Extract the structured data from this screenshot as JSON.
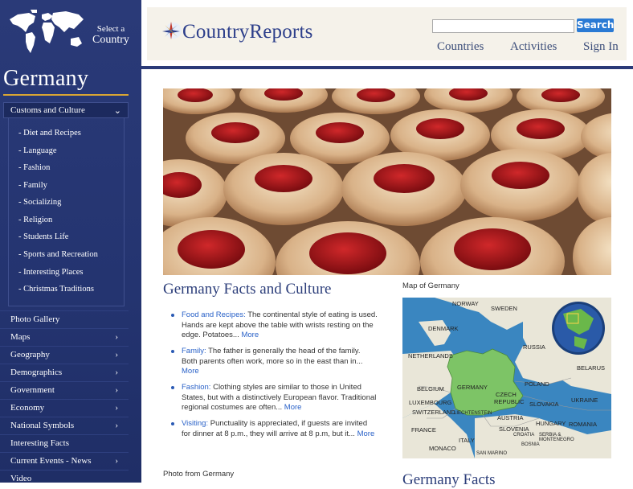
{
  "sidebar": {
    "select_line1": "Select a",
    "select_line2": "Country",
    "country": "Germany",
    "customs": "Customs and Culture",
    "submenu": [
      "- Diet and Recipes",
      "- Language",
      "- Fashion",
      "- Family",
      "- Socializing",
      "- Religion",
      "- Students Life",
      "- Sports and Recreation",
      "- Interesting Places",
      "- Christmas Traditions"
    ],
    "menu": [
      {
        "label": "Photo Gallery",
        "chevron": ""
      },
      {
        "label": "Maps",
        "chevron": "›"
      },
      {
        "label": "Geography",
        "chevron": "›"
      },
      {
        "label": "Demographics",
        "chevron": "›"
      },
      {
        "label": "Government",
        "chevron": "›"
      },
      {
        "label": "Economy",
        "chevron": "›"
      },
      {
        "label": "National Symbols",
        "chevron": "›"
      },
      {
        "label": "Interesting Facts",
        "chevron": ""
      },
      {
        "label": "Current Events - News",
        "chevron": "›"
      },
      {
        "label": "Video",
        "chevron": ""
      }
    ]
  },
  "header": {
    "logo": "CountryReports",
    "search_button": "Search",
    "search_value": "",
    "nav": [
      "Countries",
      "Activities",
      "Sign In"
    ]
  },
  "main": {
    "facts_title": "Germany Facts and Culture",
    "facts": [
      {
        "topic": "Food and Recipes:",
        "text": " The continental style of eating is used. Hands are kept above the table with wrists resting on the edge. Potatoes... ",
        "more": "More"
      },
      {
        "topic": "Family:",
        "text": " The father is generally the head of the family. Both parents often work, more so in the east than in... ",
        "more": "More"
      },
      {
        "topic": "Fashion:",
        "text": " Clothing styles are similar to those in United States, but with a distinctively European flavor. Traditional regional costumes are often... ",
        "more": "More"
      },
      {
        "topic": "Visiting:",
        "text": " Punctuality is appreciated, if guests are invited for dinner at 8 p.m., they will arrive at 8 p.m, but it... ",
        "more": "More"
      }
    ],
    "map_label": "Map of Germany",
    "map_countries": [
      "NORWAY",
      "SWEDEN",
      "DENMARK",
      "RUSSIA",
      "NETHERLANDS",
      "BELARUS",
      "BELGIUM",
      "GERMANY",
      "POLAND",
      "LUXEMBOURG",
      "CZECH",
      "REPUBLIC",
      "UKRAINE",
      "SWITZERLAND",
      "LIECHTENSTEIN",
      "SLOVAKIA",
      "AUSTRIA",
      "HUNGARY",
      "FRANCE",
      "SLOVENIA",
      "CROATIA",
      "ROMANIA",
      "SERBIA &",
      "MONTENEGRO",
      "ITALY",
      "MONACO",
      "SAN MARINO",
      "BOSNIA"
    ],
    "photo_label": "Photo from Germany",
    "facts2_title": "Germany Facts"
  }
}
